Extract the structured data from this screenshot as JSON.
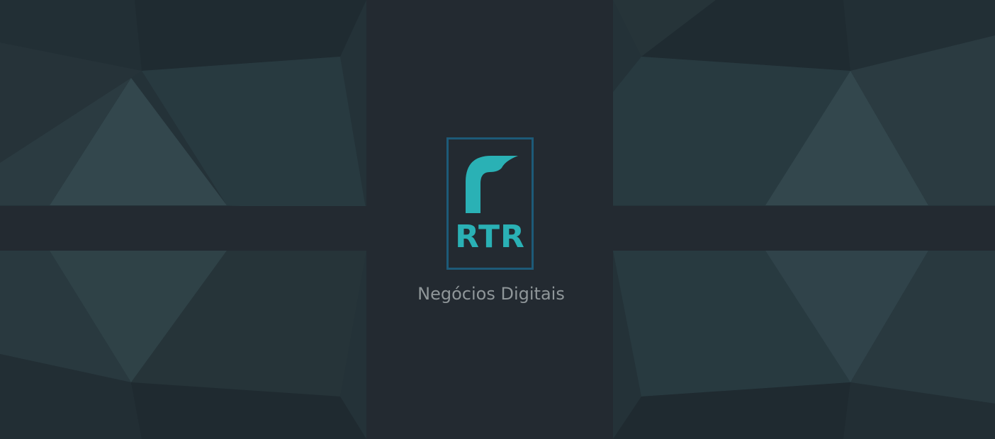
{
  "logo": {
    "text": "RTR",
    "tagline": "Negócios Digitais",
    "icon": "rtr-r-mark-icon"
  },
  "colors": {
    "background": "#243238",
    "panel": "#232a31",
    "accent": "#2ab1b5",
    "border": "#1d5a78",
    "tagline": "#8f9699"
  }
}
